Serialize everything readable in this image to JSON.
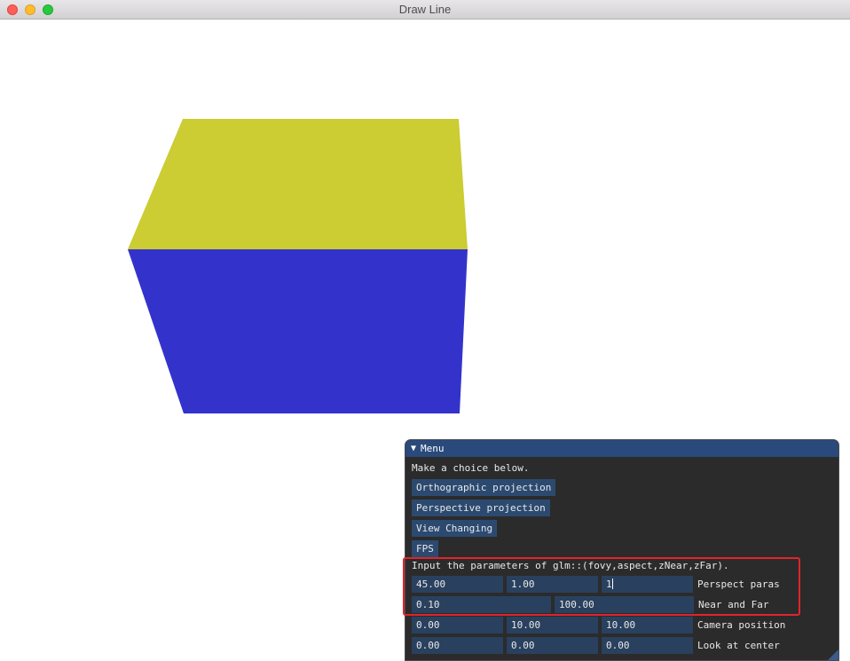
{
  "window": {
    "title": "Draw Line"
  },
  "scene": {
    "top_face_color": "#cccc33",
    "front_face_color": "#3333cc"
  },
  "menu": {
    "title": "Menu",
    "prompt": "Make a choice below.",
    "buttons": {
      "orthographic": "Orthographic projection",
      "perspective": "Perspective projection",
      "view_changing": "View Changing",
      "fps": "FPS"
    },
    "params_prompt": "Input the parameters of glm::(fovy,aspect,zNear,zFar).",
    "perspect": {
      "fovy": "45.00",
      "aspect": "1.00",
      "z_near_input": "1",
      "label": "Perspect paras"
    },
    "near_far": {
      "near": "0.10",
      "far": "100.00",
      "label": "Near and Far"
    },
    "camera": {
      "x": "0.00",
      "y": "10.00",
      "z": "10.00",
      "label": "Camera position"
    },
    "center": {
      "x": "0.00",
      "y": "0.00",
      "z": "0.00",
      "label": "Look at center"
    }
  }
}
